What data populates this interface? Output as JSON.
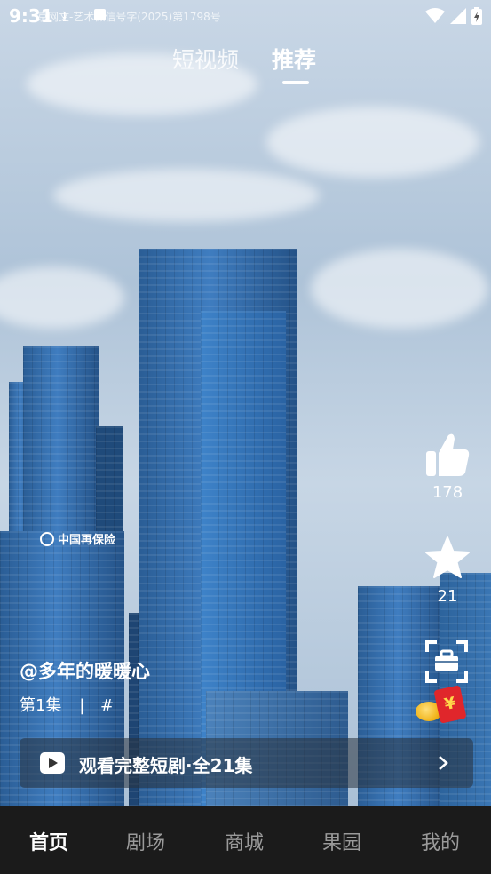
{
  "status_bar": {
    "time": "9:31",
    "license_text": "京网文-艺术微信号字(2025)第1798号"
  },
  "top_tabs": [
    {
      "label": "短视频",
      "active": false
    },
    {
      "label": "推荐",
      "active": true
    }
  ],
  "side_actions": {
    "likes": "178",
    "favorites": "21"
  },
  "video": {
    "author": "@多年的暖暖心",
    "episode": "第1集",
    "separator": "|",
    "hashtag": "#",
    "logo_text": "中国再保险"
  },
  "banner": {
    "text": "观看完整短剧·全21集"
  },
  "bottom_nav": [
    {
      "label": "首页",
      "active": true
    },
    {
      "label": "剧场",
      "active": false
    },
    {
      "label": "商城",
      "active": false
    },
    {
      "label": "果园",
      "active": false
    },
    {
      "label": "我的",
      "active": false
    }
  ],
  "colors": {
    "nav_bg": "#1b1b1b",
    "active": "#ffffff",
    "inactive": "#9a9a9a",
    "envelope": "#e0262b",
    "coin": "#f2b51c"
  }
}
